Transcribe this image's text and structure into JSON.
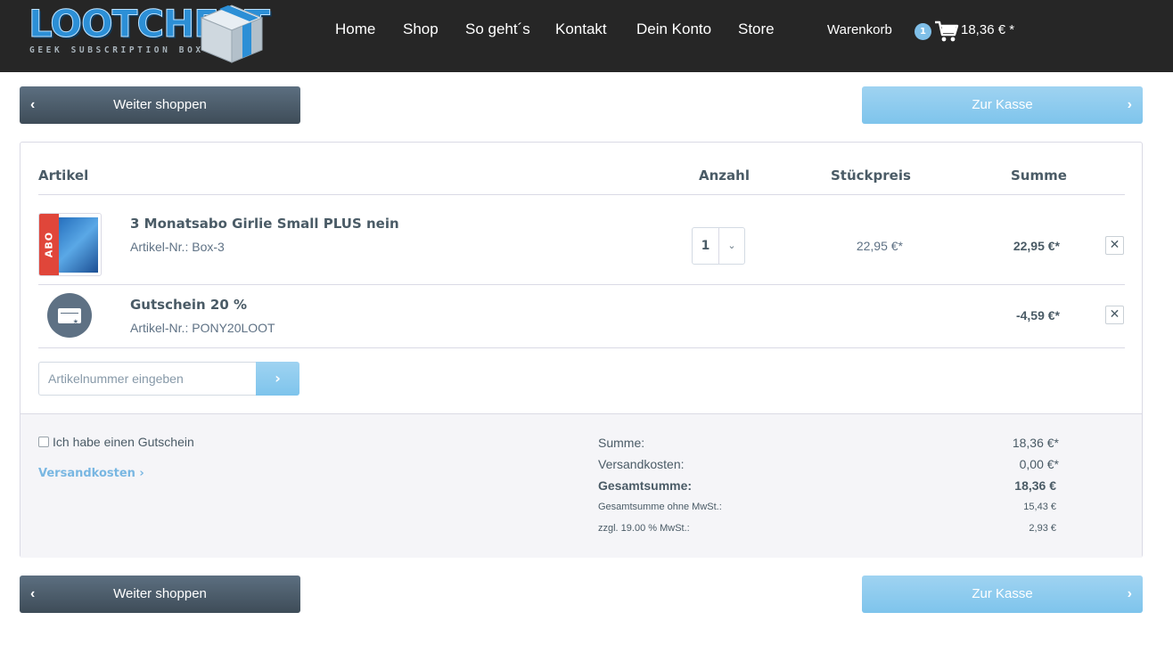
{
  "brand": {
    "logo_text": "LOOTCHEST",
    "logo_subtitle": "GEEK SUBSCRIPTION BOX"
  },
  "nav": {
    "items": [
      "Home",
      "Shop",
      "So geht´s",
      "Kontakt",
      "Dein Konto",
      "Store"
    ]
  },
  "cart_header": {
    "label": "Warenkorb",
    "count": "1",
    "total": "18,36 € *"
  },
  "actions": {
    "continue_label": "Weiter shoppen",
    "checkout_label": "Zur Kasse"
  },
  "table": {
    "headers": {
      "article": "Artikel",
      "quantity": "Anzahl",
      "unit_price": "Stückpreis",
      "sum": "Summe"
    },
    "rows": [
      {
        "badge": "ABO",
        "name": "3 Monatsabo Girlie Small PLUS nein",
        "article_number": "Artikel-Nr.: Box-3",
        "quantity": "1",
        "unit_price": "22,95 €*",
        "sum": "22,95 €*"
      },
      {
        "name": "Gutschein 20 %",
        "article_number": "Artikel-Nr.: PONY20LOOT",
        "sum": "-4,59 €*"
      }
    ]
  },
  "add_article": {
    "placeholder": "Artikelnummer eingeben"
  },
  "voucher": {
    "checkbox_label": "Ich habe einen Gutschein"
  },
  "shipping_link": "Versandkosten ›",
  "summary": {
    "subtotal_label": "Summe:",
    "subtotal_value": "18,36 €*",
    "shipping_label": "Versandkosten:",
    "shipping_value": "0,00 €*",
    "total_label": "Gesamtsumme:",
    "total_value": "18,36 €",
    "net_label": "Gesamtsumme ohne MwSt.:",
    "net_value": "15,43 €",
    "tax_label": "zzgl. 19.00 % MwSt.:",
    "tax_value": "2,93 €"
  },
  "colors": {
    "header_bg": "#262626",
    "primary_dark": "#4a5b66",
    "accent_blue": "#7ec4ec",
    "badge_red": "#e0463a"
  }
}
